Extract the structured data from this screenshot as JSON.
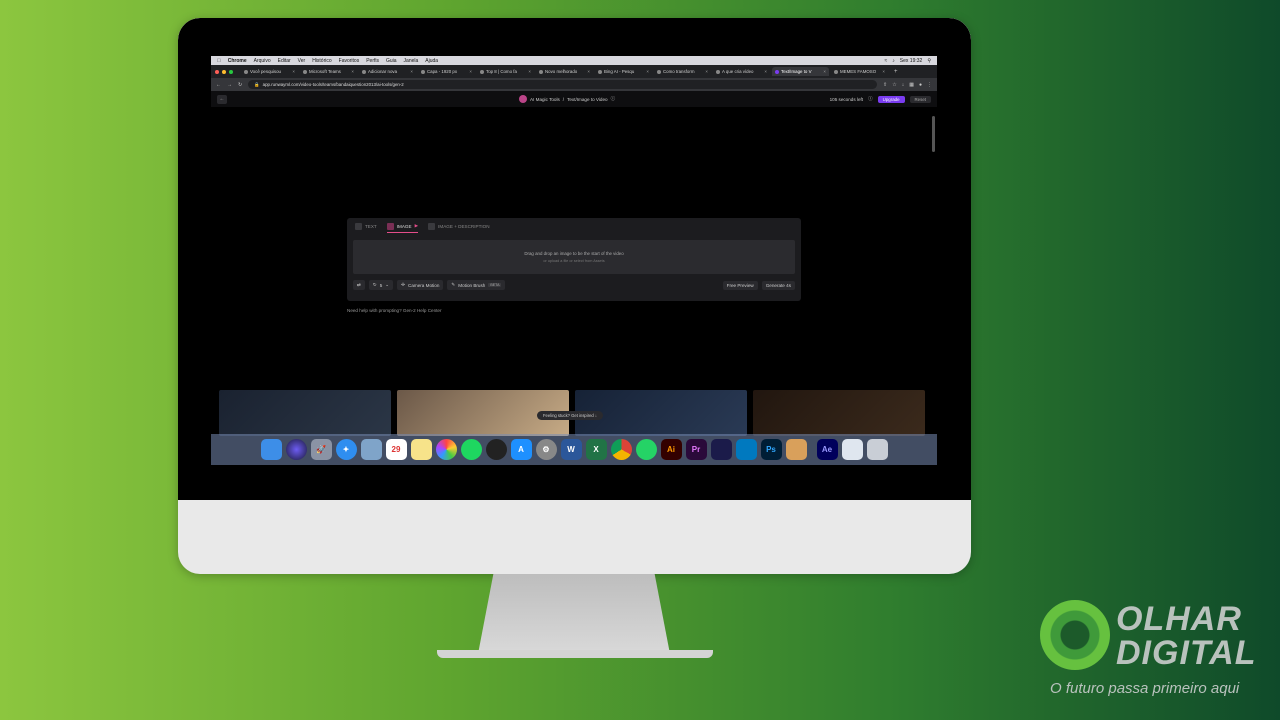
{
  "menubar": {
    "apple": "",
    "app": "Chrome",
    "items": [
      "Arquivo",
      "Editar",
      "Ver",
      "Histórico",
      "Favoritos",
      "Perfis",
      "Guia",
      "Janela",
      "Ajuda"
    ],
    "clock": "Sex 19:32"
  },
  "tabs": [
    {
      "label": "Você pesquisou"
    },
    {
      "label": "Microsoft Teams"
    },
    {
      "label": "Adicionar nova"
    },
    {
      "label": "Capa - 1920 px"
    },
    {
      "label": "Top 8 | Como fa"
    },
    {
      "label": "Novo melhorado"
    },
    {
      "label": "Bing AI - Pesqu"
    },
    {
      "label": "Como transform"
    },
    {
      "label": "A que cria vídeo"
    },
    {
      "label": "Text/Image to V",
      "active": true
    },
    {
      "label": "MEMES FAMOSO"
    }
  ],
  "address": {
    "url": "app.runwayml.com/video-tools/teams/bandaiquestion2013/ai-tools/gen-2"
  },
  "apphead": {
    "breadcrumb_root": "AI Magic Tools",
    "separator": "/",
    "breadcrumb_page": "Text/Image to Video",
    "seconds_left": "105 seconds left",
    "upgrade": "Upgrade",
    "reset": "Reset"
  },
  "panel": {
    "modes": [
      {
        "label": "TEXT",
        "active": false
      },
      {
        "label": "IMAGE",
        "active": true
      },
      {
        "label": "IMAGE + DESCRIPTION",
        "active": false
      }
    ],
    "drop_title": "Drag and drop an image to be the start of the video",
    "drop_sub": "or upload a file or select from Assets",
    "seed": "5",
    "camera_motion": "Camera Motion",
    "motion_brush": "Motion Brush",
    "beta": "BETA",
    "free_preview": "Free Preview",
    "generate": "Generate 4s"
  },
  "help_text": "Need help with prompting? Gen-2 Help Center",
  "inspire": "Feeling stuck? Get inspired",
  "dock": [
    "finder",
    "siri",
    "launchpad",
    "safari",
    "preview",
    "calendar",
    "notes",
    "photos",
    "spotify",
    "davinci",
    "app-store",
    "settings",
    "word",
    "excel",
    "chrome",
    "whatsapp",
    "illustrator",
    "premiere",
    "media-encoder",
    "trello",
    "photoshop",
    "garageband",
    "after-effects",
    "folder",
    "trash"
  ],
  "watermark": {
    "brand": "OLHAR DIGITAL",
    "tagline": "O futuro passa primeiro aqui"
  },
  "colors": {
    "accent": "#7a3cf0",
    "active_tab_underline": "#e44d8a"
  }
}
